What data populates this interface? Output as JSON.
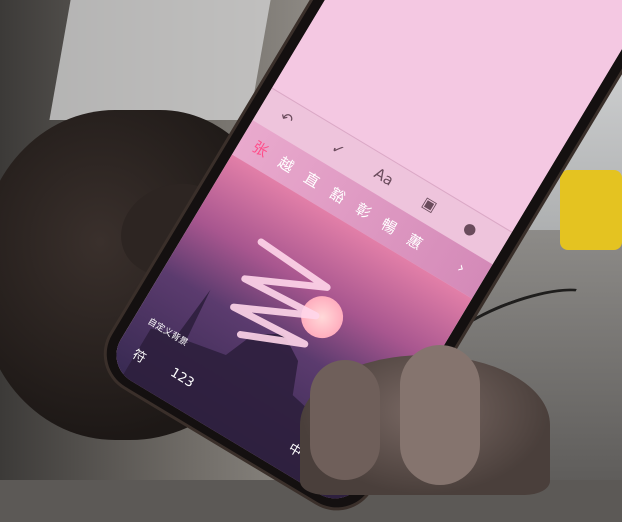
{
  "toolbar": {
    "undo": "↶",
    "check": "✓",
    "font": "Aa",
    "camera": "▣",
    "mic": "●"
  },
  "candidates": [
    "张",
    "越",
    "直",
    "豁",
    "彰",
    "暢",
    "蕙"
  ],
  "candidate_more": "›",
  "keyboard": {
    "symbol_key": "符",
    "num_key": "123",
    "lang_key": "中",
    "close_x": "✕",
    "theme_label": "自定义背景"
  },
  "colors": {
    "screen_top": "#f4c8e2",
    "candidate_bar": "#e9a9cd",
    "keyboard_gradient_top": "#e27fa8",
    "keyboard_gradient_bottom": "#382a52"
  }
}
